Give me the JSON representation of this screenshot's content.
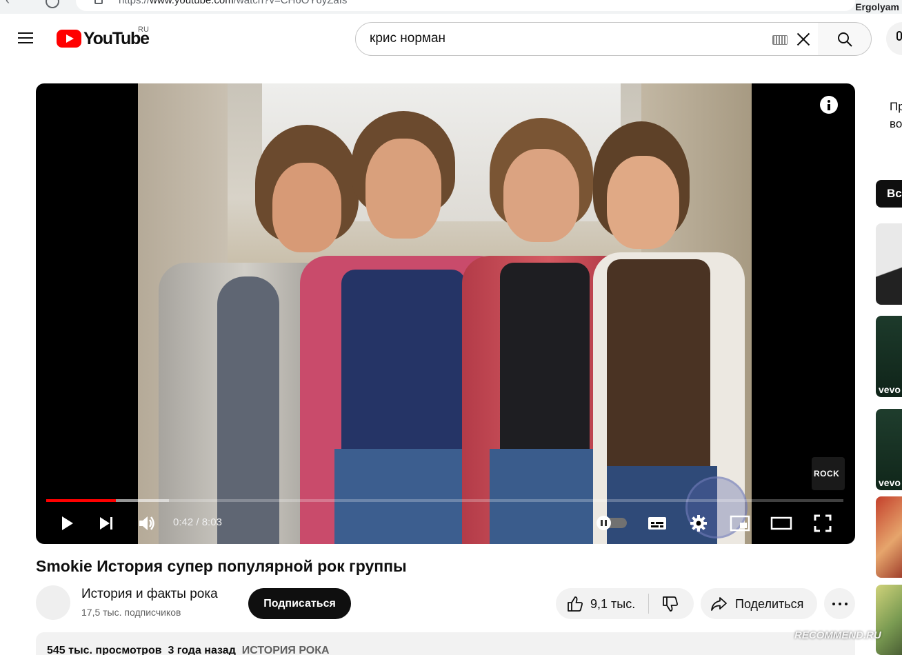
{
  "browser": {
    "url_prefix": "https://",
    "url_host": "www.youtube.com",
    "url_path": "/watch?v=CH6OY6yZaIs",
    "profile_name": "Ergolyam"
  },
  "masthead": {
    "logo_text": "YouTube",
    "country_code": "RU",
    "search_value": "крис норман",
    "icons": [
      "menu-icon",
      "youtube-logo",
      "keyboard-icon",
      "clear-icon",
      "search-icon",
      "microphone-icon"
    ]
  },
  "player": {
    "current_time": "0:42",
    "duration": "8:03",
    "time_separator": " / ",
    "progress_played_fraction": 0.087,
    "progress_buffered_fraction": 0.154,
    "badge_text": "ROCK",
    "autoplay_on": false,
    "controls": [
      "play-icon",
      "next-icon",
      "volume-icon",
      "autoplay-toggle",
      "subtitles-icon",
      "settings-icon",
      "miniplayer-icon",
      "theater-icon",
      "fullscreen-icon"
    ],
    "colors": {
      "progress": "#ff0000",
      "background": "#000000"
    }
  },
  "video": {
    "title": "Smokie История супер популярной рок группы"
  },
  "channel": {
    "name": "История и факты рока",
    "subscribers": "17,5 тыс. подписчиков",
    "subscribe_label": "Подписаться"
  },
  "actions": {
    "like_count": "9,1 тыс.",
    "share_label": "Поделиться"
  },
  "description": {
    "views": "545 тыс. просмотров",
    "age": "3 года назад",
    "hashtag": "ИСТОРИЯ РОКА"
  },
  "sidebar": {
    "text_line_1": "Пр",
    "text_line_2": "во",
    "chip_label": "Все",
    "thumb_badge": "vevo"
  },
  "watermark": {
    "text": "RECOMMEND.RU"
  }
}
